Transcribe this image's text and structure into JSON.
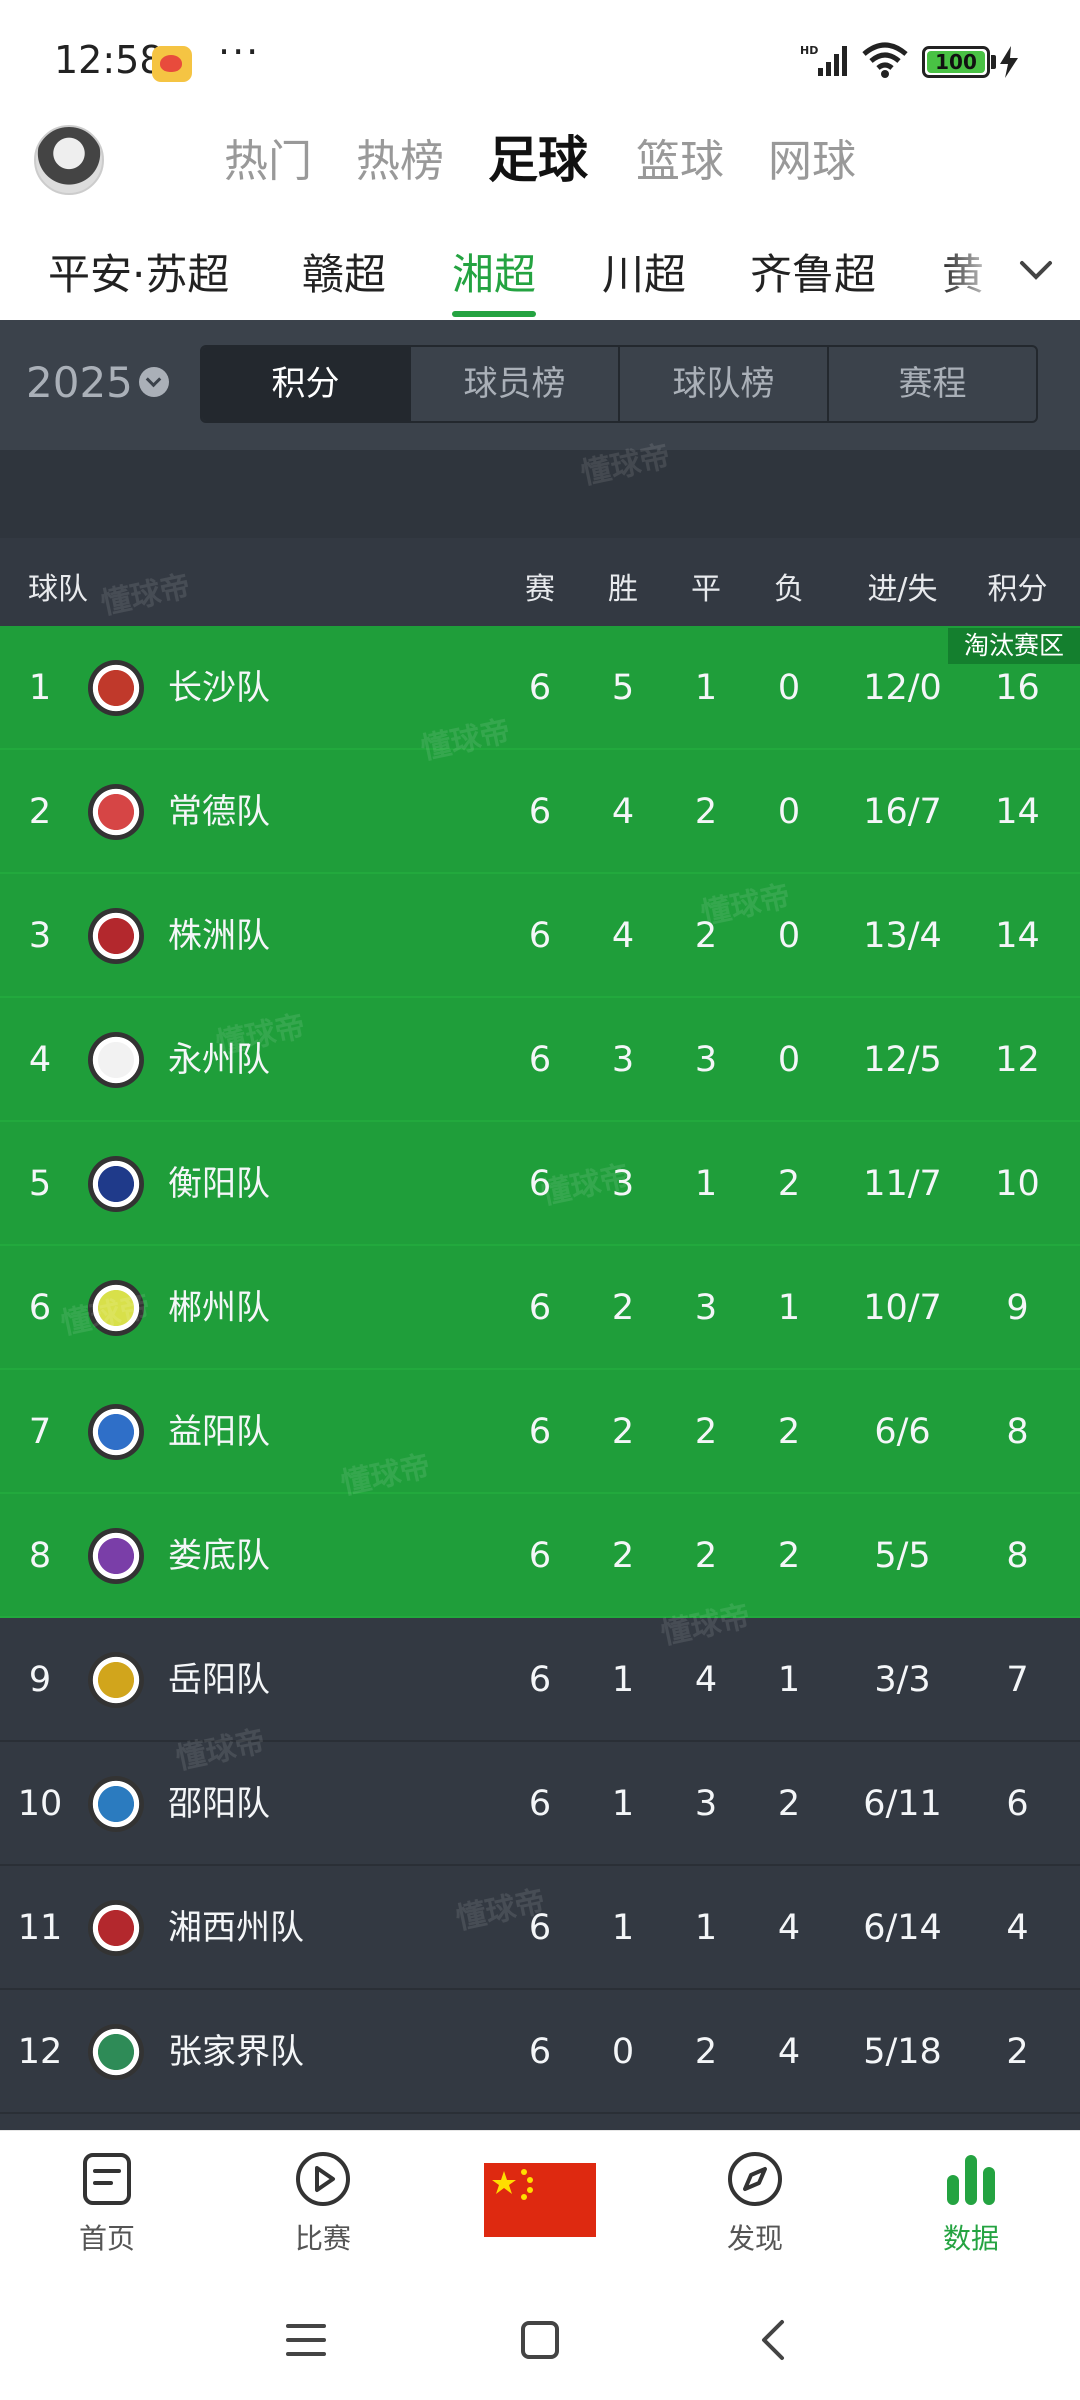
{
  "status_bar": {
    "time": "12:58",
    "dots": "···",
    "battery": "100",
    "network": "HD"
  },
  "sport_tabs": [
    "热门",
    "热榜",
    "足球",
    "篮球",
    "网球"
  ],
  "sport_active": 2,
  "league_tabs": [
    "平安·苏超",
    "赣超",
    "湘超",
    "川超",
    "齐鲁超",
    "黄"
  ],
  "league_active": 2,
  "year": "2025",
  "segments": [
    "积分",
    "球员榜",
    "球队榜",
    "赛程"
  ],
  "segment_active": 0,
  "table": {
    "headers": {
      "team": "球队",
      "played": "赛",
      "won": "胜",
      "drawn": "平",
      "lost": "负",
      "goals": "进/失",
      "points": "积分"
    },
    "zone_label": "淘汰赛区",
    "rows": [
      {
        "rank": "1",
        "team": "长沙队",
        "played": "6",
        "won": "5",
        "drawn": "1",
        "lost": "0",
        "goals": "12/0",
        "points": "16",
        "zone": "green",
        "logo_color": "#c0392b"
      },
      {
        "rank": "2",
        "team": "常德队",
        "played": "6",
        "won": "4",
        "drawn": "2",
        "lost": "0",
        "goals": "16/7",
        "points": "14",
        "zone": "green",
        "logo_color": "#d64545"
      },
      {
        "rank": "3",
        "team": "株洲队",
        "played": "6",
        "won": "4",
        "drawn": "2",
        "lost": "0",
        "goals": "13/4",
        "points": "14",
        "zone": "green",
        "logo_color": "#b3282d"
      },
      {
        "rank": "4",
        "team": "永州队",
        "played": "6",
        "won": "3",
        "drawn": "3",
        "lost": "0",
        "goals": "12/5",
        "points": "12",
        "zone": "green",
        "logo_color": "#f2f2f2"
      },
      {
        "rank": "5",
        "team": "衡阳队",
        "played": "6",
        "won": "3",
        "drawn": "1",
        "lost": "2",
        "goals": "11/7",
        "points": "10",
        "zone": "green",
        "logo_color": "#1f3a8a"
      },
      {
        "rank": "6",
        "team": "郴州队",
        "played": "6",
        "won": "2",
        "drawn": "3",
        "lost": "1",
        "goals": "10/7",
        "points": "9",
        "zone": "green",
        "logo_color": "#d8e04a"
      },
      {
        "rank": "7",
        "team": "益阳队",
        "played": "6",
        "won": "2",
        "drawn": "2",
        "lost": "2",
        "goals": "6/6",
        "points": "8",
        "zone": "green",
        "logo_color": "#2f6fc8"
      },
      {
        "rank": "8",
        "team": "娄底队",
        "played": "6",
        "won": "2",
        "drawn": "2",
        "lost": "2",
        "goals": "5/5",
        "points": "8",
        "zone": "green",
        "logo_color": "#7a3ea8"
      },
      {
        "rank": "9",
        "team": "岳阳队",
        "played": "6",
        "won": "1",
        "drawn": "4",
        "lost": "1",
        "goals": "3/3",
        "points": "7",
        "zone": "dark",
        "logo_color": "#d1a51c"
      },
      {
        "rank": "10",
        "team": "邵阳队",
        "played": "6",
        "won": "1",
        "drawn": "3",
        "lost": "2",
        "goals": "6/11",
        "points": "6",
        "zone": "dark",
        "logo_color": "#2b7bbf"
      },
      {
        "rank": "11",
        "team": "湘西州队",
        "played": "6",
        "won": "1",
        "drawn": "1",
        "lost": "4",
        "goals": "6/14",
        "points": "4",
        "zone": "dark",
        "logo_color": "#b3282d"
      },
      {
        "rank": "12",
        "team": "张家界队",
        "played": "6",
        "won": "0",
        "drawn": "2",
        "lost": "4",
        "goals": "5/18",
        "points": "2",
        "zone": "dark",
        "logo_color": "#2e8b57"
      }
    ]
  },
  "watermark_text": "懂球帝",
  "bottom_nav": [
    {
      "label": "首页",
      "icon": "home-doc-icon"
    },
    {
      "label": "比赛",
      "icon": "play-icon"
    },
    {
      "label": "",
      "icon": "china-flag-icon"
    },
    {
      "label": "发现",
      "icon": "discover-icon"
    },
    {
      "label": "数据",
      "icon": "data-bars-icon"
    }
  ],
  "bottom_active": 4,
  "colors": {
    "accent": "#24a341",
    "green_row": "#1f9e3a",
    "dark_row": "#333942"
  }
}
